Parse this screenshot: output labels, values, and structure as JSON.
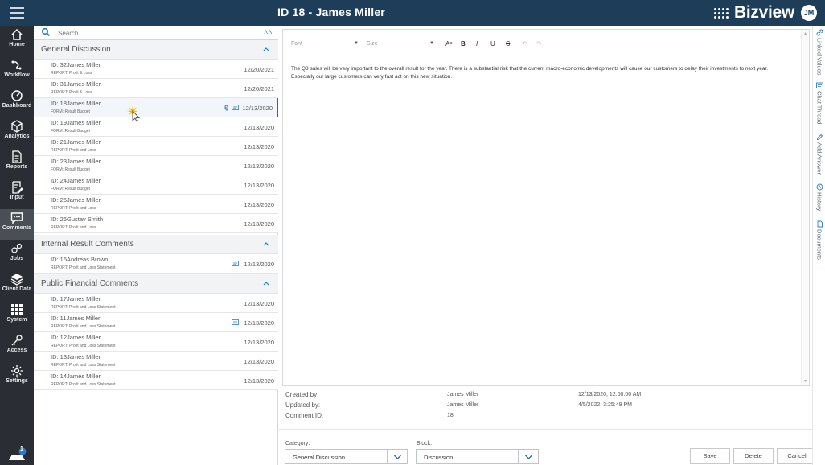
{
  "window": {
    "title": "ID 18 - James Miller"
  },
  "brand": {
    "name": "Bizview",
    "user_initials": "JM"
  },
  "nav": {
    "items": [
      {
        "label": "Home",
        "icon": "home-icon"
      },
      {
        "label": "Workflow",
        "icon": "workflow-icon"
      },
      {
        "label": "Dashboard",
        "icon": "dashboard-icon"
      },
      {
        "label": "Analytics",
        "icon": "analytics-icon"
      },
      {
        "label": "Reports",
        "icon": "reports-icon"
      },
      {
        "label": "Input",
        "icon": "input-icon"
      },
      {
        "label": "Comments",
        "icon": "comments-icon"
      },
      {
        "label": "Jobs",
        "icon": "jobs-icon"
      },
      {
        "label": "Client Data",
        "icon": "client-data-icon"
      },
      {
        "label": "System",
        "icon": "system-icon"
      },
      {
        "label": "Access",
        "icon": "access-icon"
      },
      {
        "label": "Settings",
        "icon": "settings-icon"
      }
    ],
    "active": "Comments",
    "notification_count": "1"
  },
  "search": {
    "placeholder": "Search"
  },
  "groups": [
    {
      "title": "General Discussion",
      "rows": [
        {
          "title": "ID: 32James Miller",
          "sub": "REPORT: Profit & Loss",
          "date": "12/20/2021"
        },
        {
          "title": "ID: 31James Miller",
          "sub": "REPORT: Profit & Loss",
          "date": "12/20/2021"
        },
        {
          "title": "ID: 18James Miller",
          "sub": "FORM: Result Budget",
          "date": "12/13/2020"
        },
        {
          "title": "ID: 19James Miller",
          "sub": "FORM: Result Budget",
          "date": "12/13/2020"
        },
        {
          "title": "ID: 21James Miller",
          "sub": "REPORT: Profit and Loss",
          "date": "12/13/2020"
        },
        {
          "title": "ID: 23James Miller",
          "sub": "FORM: Result Budget",
          "date": "12/13/2020"
        },
        {
          "title": "ID: 24James Miller",
          "sub": "FORM: Result Budget",
          "date": "12/13/2020"
        },
        {
          "title": "ID: 25James Miller",
          "sub": "REPORT: Profit and Loss",
          "date": "12/13/2020"
        },
        {
          "title": "ID: 26Gustav Smith",
          "sub": "REPORT: Profit and Loss",
          "date": "12/13/2020"
        }
      ]
    },
    {
      "title": "Internal Result Comments",
      "rows": [
        {
          "title": "ID: 15Andreas Brown",
          "sub": "REPORT: Profit and Loss Statement",
          "date": "12/13/2020"
        }
      ]
    },
    {
      "title": "Public Financial Comments",
      "rows": [
        {
          "title": "ID: 17James Miller",
          "sub": "REPORT: Profit and Loss Statement",
          "date": "12/13/2020"
        },
        {
          "title": "ID: 11James Miller",
          "sub": "REPORT: Profit and Loss Statement",
          "date": "12/13/2020"
        },
        {
          "title": "ID: 12James Miller",
          "sub": "REPORT: Profit and Loss Statement",
          "date": "12/13/2020"
        },
        {
          "title": "ID: 13James Miller",
          "sub": "REPORT: Profit and Loss Statement",
          "date": "12/13/2020"
        },
        {
          "title": "ID: 14James Miller",
          "sub": "REPORT: Profit and Loss Statement",
          "date": "12/13/2020"
        }
      ]
    }
  ],
  "editor": {
    "font_placeholder": "Font",
    "size_placeholder": "Size",
    "tools": {
      "font_size": "Aᵃ",
      "bold": "B",
      "italic": "I",
      "underline": "U",
      "strike": "S",
      "undo": "↶",
      "redo": "↷"
    },
    "body": "The Q3 sales will be very important to the overall result for the year. There is a substantial risk that the current macro-economic developments will cause our customers to delay their investments to next year. Especially our large customers can very fast act on this new situation."
  },
  "meta": {
    "created_by_label": "Created by:",
    "updated_by_label": "Updated by:",
    "comment_id_label": "Comment ID:",
    "created_by": "James Miller",
    "updated_by": "James Miller",
    "comment_id": "18",
    "created_at": "12/13/2020, 12:00:00 AM",
    "updated_at": "4/5/2022, 3:25:49 PM"
  },
  "form": {
    "category_label": "Category:",
    "category_value": "General Discussion",
    "block_label": "Block:",
    "block_value": "Discussion"
  },
  "actions": {
    "save": "Save",
    "delete": "Delete",
    "cancel": "Cancel"
  },
  "side_tabs": [
    {
      "label": "Linked Values",
      "icon": "link-icon"
    },
    {
      "label": "Chat Thread",
      "icon": "chat-icon"
    },
    {
      "label": "Add Answer",
      "icon": "pencil-icon"
    },
    {
      "label": "History",
      "icon": "history-icon"
    },
    {
      "label": "Documents",
      "icon": "documents-icon"
    }
  ],
  "colors": {
    "topbar": "#1e3d59",
    "nav": "#2a2d33",
    "accent": "#2b7bd3"
  }
}
